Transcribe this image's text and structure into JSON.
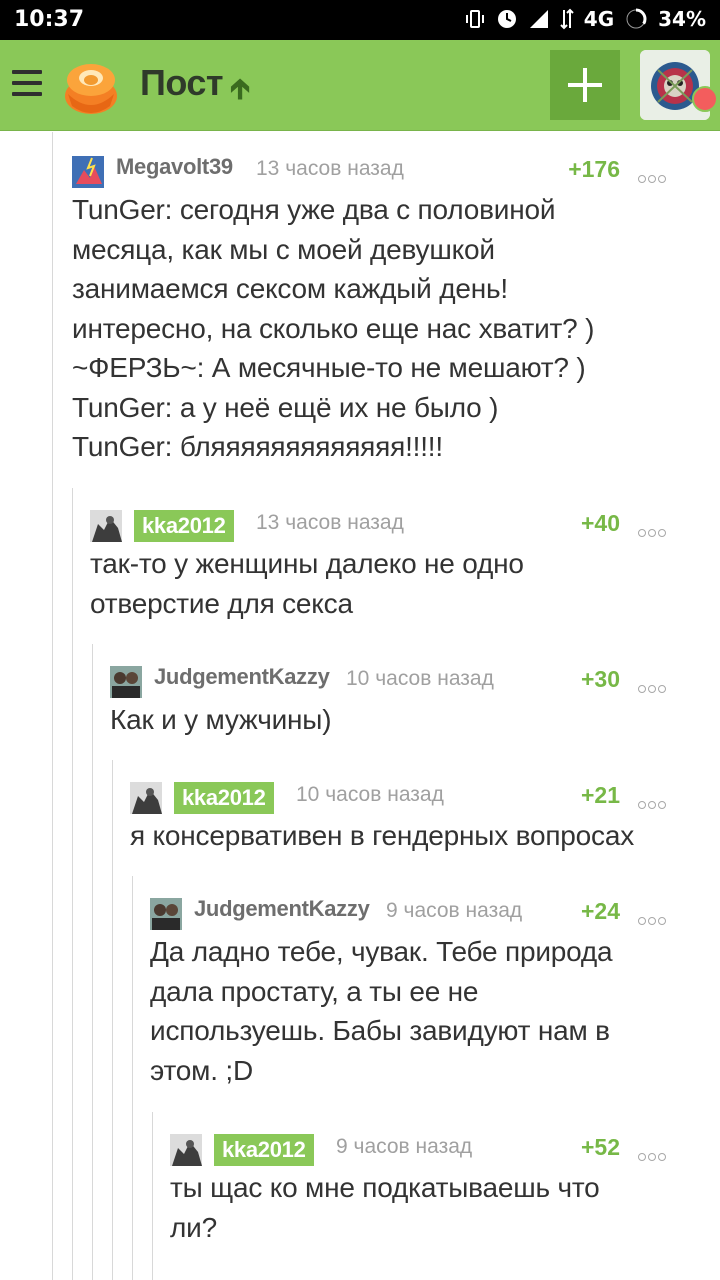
{
  "status_bar": {
    "time": "10:37",
    "network": "4G",
    "battery": "34%"
  },
  "header": {
    "title": "Пост"
  },
  "comments": [
    {
      "author": "Megavolt39",
      "time": "13 часов назад",
      "rating": "+176",
      "is_op": false,
      "lines": [
        "TunGer: сегодня уже два с половиной",
        "месяца, как мы с моей девушкой",
        "занимаемся сексом каждый день!",
        "интересно, на сколько еще нас хватит? )",
        "~ФЕРЗЬ~: А месячные-то не мешают? )",
        "TunGer: а у неё ещё их не было )",
        "TunGer: бляяяяяяяяяяяяя!!!!!"
      ]
    },
    {
      "author": "kka2012",
      "time": "13 часов назад",
      "rating": "+40",
      "is_op": true,
      "lines": [
        "так-то у женщины далеко не одно",
        "отверстие для секса"
      ]
    },
    {
      "author": "JudgementKazzy",
      "time": "10 часов назад",
      "rating": "+30",
      "is_op": false,
      "lines": [
        "Как и у мужчины)"
      ]
    },
    {
      "author": "kka2012",
      "time": "10 часов назад",
      "rating": "+21",
      "is_op": true,
      "lines": [
        "я консервативен в гендерных вопросах"
      ]
    },
    {
      "author": "JudgementKazzy",
      "time": "9 часов назад",
      "rating": "+24",
      "is_op": false,
      "lines": [
        "Да ладно тебе, чувак. Тебе природа",
        "дала простату, а ты ее не",
        "используешь. Бабы завидуют нам в",
        "этом. ;D"
      ]
    },
    {
      "author": "kka2012",
      "time": "9 часов назад",
      "rating": "+52",
      "is_op": true,
      "lines": [
        "ты щас ко мне подкатываешь что",
        "ли?"
      ]
    }
  ],
  "colors": {
    "appbar": "#8ac858",
    "accent": "#77b847",
    "op_badge": "#8ac858",
    "notification": "#f35d5d"
  }
}
